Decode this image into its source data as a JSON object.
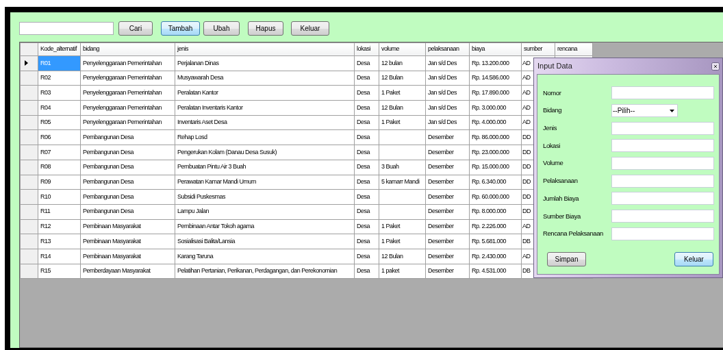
{
  "toolbar": {
    "buttons": [
      {
        "label": "Cari",
        "focused": false
      },
      {
        "label": "Tambah",
        "focused": true
      },
      {
        "label": "Ubah",
        "focused": false
      },
      {
        "label": "Hapus",
        "focused": false
      },
      {
        "label": "Keluar",
        "focused": false
      }
    ]
  },
  "table": {
    "columns": [
      "Kode_alternatif",
      "bidang",
      "jenis",
      "lokasi",
      "volume",
      "pelaksanaan",
      "biaya",
      "sumber",
      "rencana"
    ],
    "rows": [
      {
        "selected": true,
        "kode_alternatif": "R01",
        "bidang": "Penyelenggaraan Pemerintahan",
        "jenis": "Perjalanan Dinas",
        "lokasi": "Desa",
        "volume": "12 bulan",
        "pelaksanaan": "Jan s/d Des",
        "biaya": "Rp. 13.200.000",
        "sumber": "AD"
      },
      {
        "selected": false,
        "kode_alternatif": "R02",
        "bidang": "Penyelenggaraan Pemerintahan",
        "jenis": "Musyawarah Desa",
        "lokasi": "Desa",
        "volume": "12 Bulan",
        "pelaksanaan": "Jan s/d Des",
        "biaya": "Rp. 14.586.000",
        "sumber": "AD"
      },
      {
        "selected": false,
        "kode_alternatif": "R03",
        "bidang": "Penyelenggaraan Pemerintahan",
        "jenis": "Peralatan Kantor",
        "lokasi": "Desa",
        "volume": "1 Paket",
        "pelaksanaan": "Jan s/d Des",
        "biaya": "Rp. 17.890.000",
        "sumber": "AD"
      },
      {
        "selected": false,
        "kode_alternatif": "R04",
        "bidang": "Penyelenggaraan Pemerintahan",
        "jenis": "Peralatan Inventaris Kantor",
        "lokasi": "Desa",
        "volume": "12 Bulan",
        "pelaksanaan": "Jan s/d Des",
        "biaya": "Rp. 3.000.000",
        "sumber": "AD"
      },
      {
        "selected": false,
        "kode_alternatif": "R05",
        "bidang": "Penyelenggaraan Pemerintahan",
        "jenis": "Inventaris Aset Desa",
        "lokasi": "Desa",
        "volume": "1 Paket",
        "pelaksanaan": "Jan s/d Des",
        "biaya": "Rp. 4.000.000",
        "sumber": "AD"
      },
      {
        "selected": false,
        "kode_alternatif": "R06",
        "bidang": "Pembangunan Desa",
        "jenis": "Rehap Losd",
        "lokasi": "Desa",
        "pelaksanaan": "Desember",
        "biaya": "Rp. 86.000.000",
        "sumber": "DD"
      },
      {
        "selected": false,
        "kode_alternatif": "R07",
        "bidang": "Pembangunan Desa",
        "jenis": "Pengerukan Kolam (Danau Desa Susuk)",
        "lokasi": "Desa",
        "pelaksanaan": "Desember",
        "biaya": "Rp. 23.000.000",
        "sumber": "DD"
      },
      {
        "selected": false,
        "kode_alternatif": "R08",
        "bidang": "Pembangunan Desa",
        "jenis": "Pembuatan Pintu Air 3 Buah",
        "lokasi": "Desa",
        "volume": "3 Buah",
        "pelaksanaan": "Desember",
        "biaya": "Rp. 15.000.000",
        "sumber": "DD"
      },
      {
        "selected": false,
        "kode_alternatif": "R09",
        "bidang": "Pembangunan Desa",
        "jenis": "Perawatan Kamar Mandi Umum",
        "lokasi": "Desa",
        "volume": "5 kamarr Mandi",
        "pelaksanaan": "Desember",
        "biaya": "Rp. 6.340.000",
        "sumber": "DD"
      },
      {
        "selected": false,
        "kode_alternatif": "R10",
        "bidang": "Pembangunan Desa",
        "jenis": "Subsidi Puskesmas",
        "lokasi": "Desa",
        "pelaksanaan": "Desember",
        "biaya": "Rp. 60.000.000",
        "sumber": "DD"
      },
      {
        "selected": false,
        "kode_alternatif": "R11",
        "bidang": "Pembangunan Desa",
        "jenis": "Lampu Jalan",
        "lokasi": "Desa",
        "pelaksanaan": "Desember",
        "biaya": "Rp. 8.000.000",
        "sumber": "DD"
      },
      {
        "selected": false,
        "kode_alternatif": "R12",
        "bidang": "Pembinaan Masyarakat",
        "jenis": "Pembinaan Antar Tokoh agama",
        "lokasi": "Desa",
        "volume": "1 Paket",
        "pelaksanaan": "Desember",
        "biaya": "Rp. 2.226.000",
        "sumber": "AD"
      },
      {
        "selected": false,
        "kode_alternatif": "R13",
        "bidang": "Pembinaan Masyarakat",
        "jenis": "Sosialisasi Balita/Lansia",
        "lokasi": "Desa",
        "volume": "1 Paket",
        "pelaksanaan": "Desember",
        "biaya": "Rp. 5.681.000",
        "sumber": "DB"
      },
      {
        "selected": false,
        "kode_alternatif": "R14",
        "bidang": "Pembinaan Masyarakat",
        "jenis": "Karang Taruna",
        "lokasi": "Desa",
        "volume": "12 Bulan",
        "pelaksanaan": "Desember",
        "biaya": "Rp. 2.430.000",
        "sumber": "AD"
      },
      {
        "selected": false,
        "kode_alternatif": "R15",
        "bidang": "Pemberdayaan Masyarakat",
        "jenis": "Pelatihan Pertanian, Perikanan, Perdagangan, dan Perekonomian",
        "lokasi": "Desa",
        "volume": "1 paket",
        "pelaksanaan": "Desember",
        "biaya": "Rp. 4.531.000",
        "sumber": "DB"
      }
    ]
  },
  "dialog": {
    "title": "Input Data",
    "fields": [
      {
        "label": "Nomor",
        "kind": "text"
      },
      {
        "label": "Bidang",
        "kind": "select",
        "value": "--Pilih--"
      },
      {
        "label": "Jenis",
        "kind": "text"
      },
      {
        "label": "Lokasi",
        "kind": "text"
      },
      {
        "label": "Volume",
        "kind": "text"
      },
      {
        "label": "Pelaksanaan",
        "kind": "text"
      },
      {
        "label": "Jumlah Biaya",
        "kind": "text"
      },
      {
        "label": "Sumber Biaya",
        "kind": "text"
      },
      {
        "label": "Rencana Pelaksanaan",
        "kind": "text"
      }
    ],
    "buttons": [
      {
        "label": "Simpan",
        "focused": false
      },
      {
        "label": "Keluar",
        "focused": true
      }
    ]
  }
}
